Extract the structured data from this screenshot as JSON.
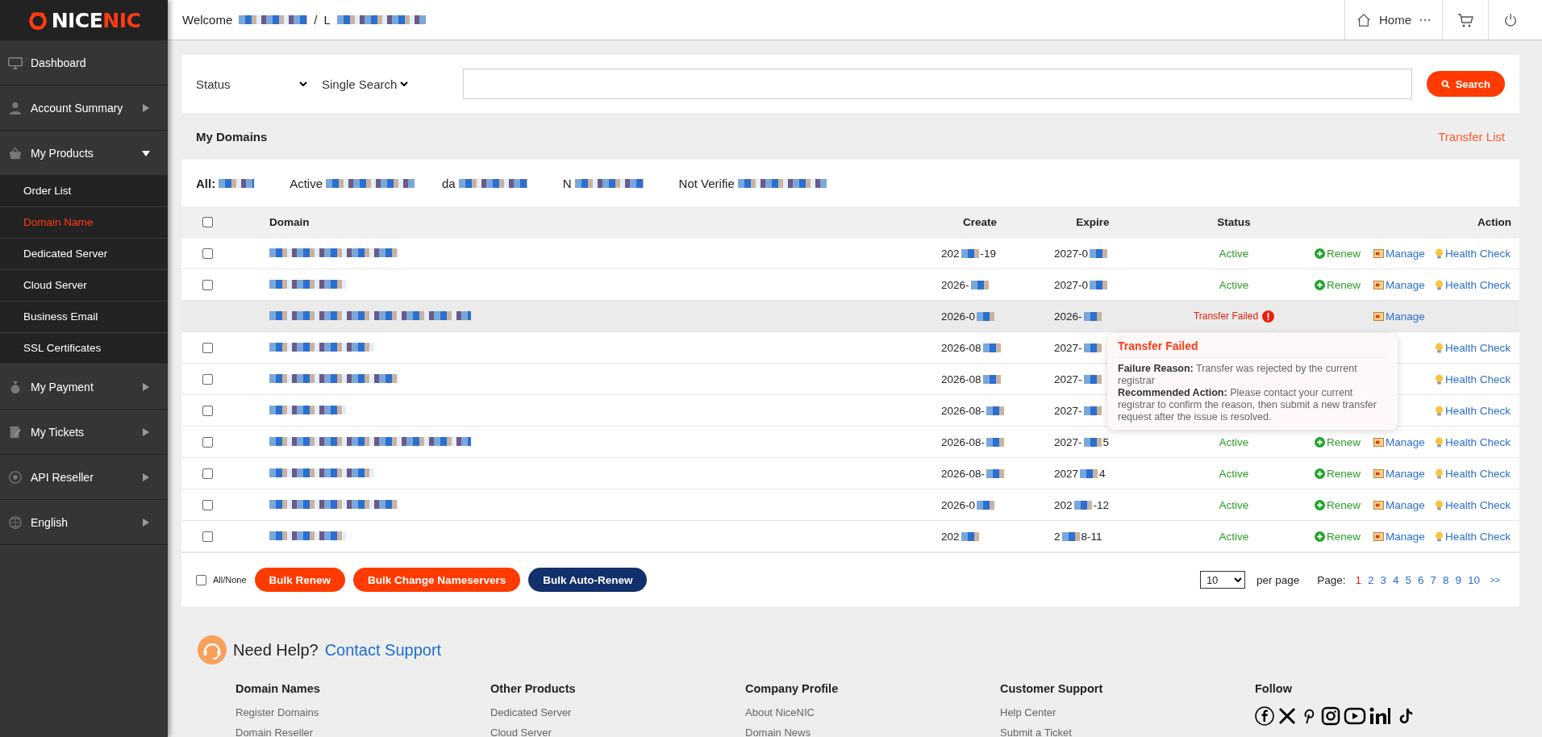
{
  "logo": {
    "part1": "NICE",
    "part2": "NIC"
  },
  "sidebar": {
    "items": [
      {
        "label": "Dashboard"
      },
      {
        "label": "Account Summary",
        "expanded": false
      },
      {
        "label": "My Products",
        "expanded": true,
        "children": [
          {
            "label": "Order List",
            "selected": false
          },
          {
            "label": "Domain Name",
            "selected": true
          },
          {
            "label": "Dedicated Server",
            "selected": false
          },
          {
            "label": "Cloud Server",
            "selected": false
          },
          {
            "label": "Business Email",
            "selected": false
          },
          {
            "label": "SSL Certificates",
            "selected": false
          }
        ]
      },
      {
        "label": "My Payment",
        "expanded": false
      },
      {
        "label": "My Tickets",
        "expanded": false
      },
      {
        "label": "API Reseller",
        "expanded": false
      },
      {
        "label": "English",
        "expanded": false
      }
    ]
  },
  "header": {
    "welcome": "Welcome",
    "separator": "/",
    "user_initial": "L",
    "home": "Home"
  },
  "search": {
    "status": "Status",
    "mode": "Single Search",
    "button": "Search"
  },
  "section": {
    "title": "My Domains",
    "link": "Transfer List"
  },
  "filters": [
    "All:",
    "Active",
    "da",
    "N",
    "Not Verifie"
  ],
  "table": {
    "header_checked": false,
    "columns": [
      "Domain",
      "Create",
      "Expire",
      "Status",
      "Action"
    ],
    "rows": [
      {
        "checked": false,
        "create": {
          "start": "202",
          "end": "-19"
        },
        "expire": {
          "start": "2027-0"
        },
        "status": {
          "kind": "active",
          "label": "Active"
        },
        "actions": [
          {
            "kind": "renew",
            "label": "Renew"
          },
          {
            "kind": "manage",
            "label": "Manage"
          },
          {
            "kind": "health",
            "label": "Health Check"
          }
        ]
      },
      {
        "checked": false,
        "create": {
          "start": "2026-"
        },
        "expire": {
          "start": "2027-0"
        },
        "status": {
          "kind": "active",
          "label": "Active"
        },
        "actions": [
          {
            "kind": "renew",
            "label": "Renew"
          },
          {
            "kind": "manage",
            "label": "Manage"
          },
          {
            "kind": "health",
            "label": "Health Check"
          }
        ]
      },
      {
        "create": {
          "start": "2026-0"
        },
        "expire": {
          "start": "2026-"
        },
        "status": {
          "kind": "failed",
          "label": "Transfer Failed"
        },
        "tooltip": {
          "title": "Transfer Failed",
          "lines": [
            "**Failure Reason:** Transfer was rejected by the current registrar",
            "**Recommended Action:** Please contact your current registrar to confirm the reason, then submit a new transfer request after the issue is resolved."
          ]
        },
        "actions": [
          {
            "kind": "manage",
            "label": "Manage"
          }
        ]
      },
      {
        "checked": false,
        "create": {
          "start": "2026-08"
        },
        "expire": {
          "start": "2027-"
        },
        "actions": [
          {
            "kind": "health",
            "label": "Health Check"
          }
        ]
      },
      {
        "checked": false,
        "create": {
          "start": "2026-08"
        },
        "expire": {
          "start": "2027-"
        },
        "actions": [
          {
            "kind": "health",
            "label": "Health Check"
          }
        ]
      },
      {
        "checked": false,
        "create": {
          "start": "2026-08-"
        },
        "expire": {
          "start": "2027-"
        },
        "actions": [
          {
            "kind": "health",
            "label": "Health Check"
          }
        ]
      },
      {
        "checked": false,
        "create": {
          "start": "2026-08-"
        },
        "expire": {
          "start": "2027-",
          "end": "5"
        },
        "status": {
          "kind": "active",
          "label": "Active"
        },
        "actions": [
          {
            "kind": "renew",
            "label": "Renew"
          },
          {
            "kind": "manage",
            "label": "Manage"
          },
          {
            "kind": "health",
            "label": "Health Check"
          }
        ]
      },
      {
        "checked": false,
        "create": {
          "start": "2026-08-"
        },
        "expire": {
          "start": "2027",
          "end": "4"
        },
        "status": {
          "kind": "active",
          "label": "Active"
        },
        "actions": [
          {
            "kind": "renew",
            "label": "Renew"
          },
          {
            "kind": "manage",
            "label": "Manage"
          },
          {
            "kind": "health",
            "label": "Health Check"
          }
        ]
      },
      {
        "checked": false,
        "create": {
          "start": "2026-0"
        },
        "expire": {
          "start": "202",
          "end": "-12"
        },
        "status": {
          "kind": "active",
          "label": "Active"
        },
        "actions": [
          {
            "kind": "renew",
            "label": "Renew"
          },
          {
            "kind": "manage",
            "label": "Manage"
          },
          {
            "kind": "health",
            "label": "Health Check"
          }
        ]
      },
      {
        "checked": false,
        "create": {
          "start": "202"
        },
        "expire": {
          "start": "2",
          "end": "8-11"
        },
        "status": {
          "kind": "active",
          "label": "Active"
        },
        "actions": [
          {
            "kind": "renew",
            "label": "Renew"
          },
          {
            "kind": "manage",
            "label": "Manage"
          },
          {
            "kind": "health",
            "label": "Health Check"
          }
        ]
      }
    ]
  },
  "bulk": {
    "all_none": {
      "label": "All/None",
      "checked": false
    },
    "buttons": [
      {
        "label": "Bulk Renew",
        "kind": "danger"
      },
      {
        "label": "Bulk Change Nameservers",
        "kind": "danger"
      },
      {
        "label": "Bulk Auto-Renew",
        "kind": "primary"
      }
    ]
  },
  "pagination": {
    "per_page": "10",
    "per_page_label": "per page",
    "page_label": "Page:",
    "pages": [
      {
        "label": "1",
        "selected": true
      },
      {
        "label": "2",
        "selected": false
      },
      {
        "label": "3",
        "selected": false
      },
      {
        "label": "4",
        "selected": false
      },
      {
        "label": "5",
        "selected": false
      },
      {
        "label": "6",
        "selected": false
      },
      {
        "label": "7",
        "selected": false
      },
      {
        "label": "8",
        "selected": false
      },
      {
        "label": "9",
        "selected": false
      },
      {
        "label": "10",
        "selected": false
      }
    ],
    "next": ">>"
  },
  "footer": {
    "help": "Need Help?",
    "help_link": "Contact Support",
    "columns": [
      {
        "title": "Domain Names",
        "links": [
          "Register Domains",
          "Domain Reseller"
        ]
      },
      {
        "title": "Other Products",
        "links": [
          "Dedicated Server",
          "Cloud Server"
        ]
      },
      {
        "title": "Company Profile",
        "links": [
          "About NiceNIC",
          "Domain News"
        ]
      },
      {
        "title": "Customer Support",
        "links": [
          "Help Center",
          "Submit a Ticket"
        ]
      }
    ],
    "follow": "Follow"
  }
}
